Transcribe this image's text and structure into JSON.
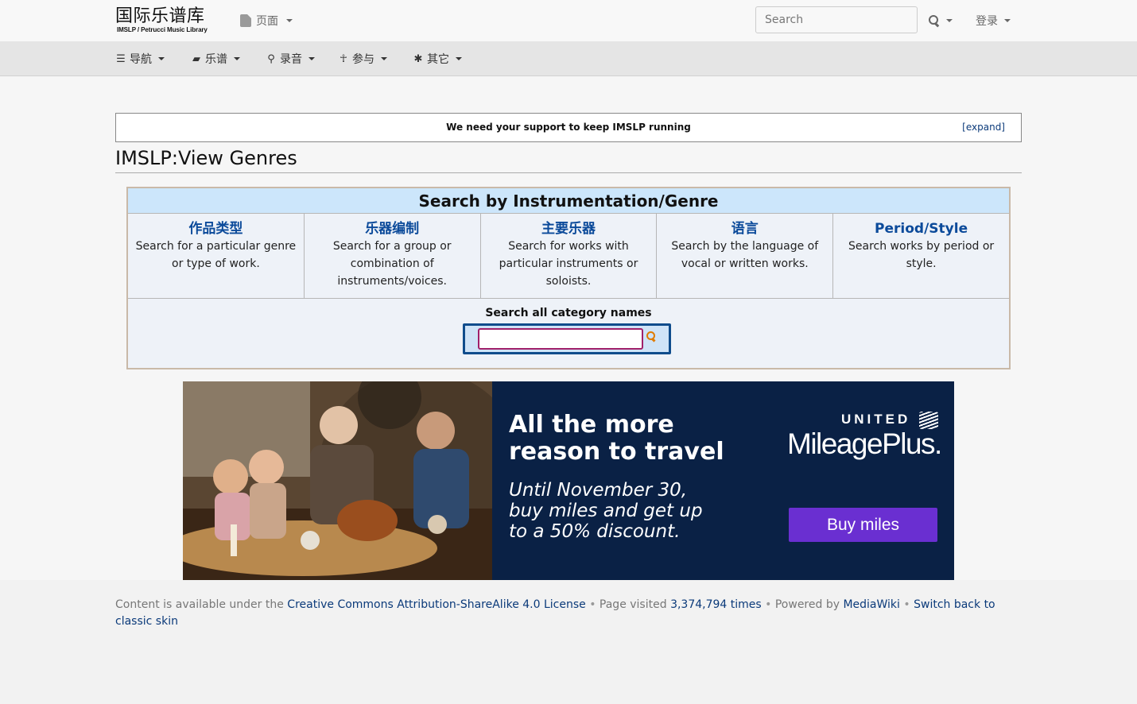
{
  "header": {
    "logo_title": "国际乐谱库",
    "logo_subtitle": "IMSLP / Petrucci Music Library",
    "page_menu_label": "页面",
    "search_placeholder": "Search",
    "login_label": "登录"
  },
  "nav": {
    "items": [
      {
        "label": "导航",
        "icon": "menu-icon"
      },
      {
        "label": "乐谱",
        "icon": "book-icon"
      },
      {
        "label": "录音",
        "icon": "microphone-icon"
      },
      {
        "label": "参与",
        "icon": "person-icon"
      },
      {
        "label": "其它",
        "icon": "asterisk-icon"
      }
    ]
  },
  "support": {
    "text": "We need your support to keep IMSLP running",
    "expand_label": "[expand]"
  },
  "page": {
    "title": "IMSLP:View Genres"
  },
  "genre_table": {
    "header": "Search by Instrumentation/Genre",
    "columns": [
      {
        "title": "作品类型",
        "desc": "Search for a particular genre or type of work."
      },
      {
        "title": "乐器编制",
        "desc": "Search for a group or combination of instruments/voices."
      },
      {
        "title": "主要乐器",
        "desc": "Search for works with particular instruments or soloists."
      },
      {
        "title": "语言",
        "desc": "Search by the language of vocal or written works."
      },
      {
        "title": "Period/Style",
        "desc": "Search works by period or style."
      }
    ],
    "category_label": "Search all category names",
    "category_value": ""
  },
  "ad": {
    "headline": "All the more reason to travel",
    "subtext": "Until November 30, buy miles and get up to a 50% discount.",
    "brand_small": "UNITED",
    "brand": "MileagePlus.",
    "button_label": "Buy miles",
    "colors": {
      "background": "#0a2145",
      "button": "#6a2fd1"
    }
  },
  "footer": {
    "prefix": "Content is available under the ",
    "license_link": "Creative Commons Attribution-ShareAlike 4.0 License",
    "visited_prefix": " Page visited ",
    "visited_count": "3,374,794 times",
    "powered_prefix": " Powered by ",
    "powered_link": "MediaWiki",
    "switch_link": "Switch back to classic skin",
    "separator": "•"
  }
}
